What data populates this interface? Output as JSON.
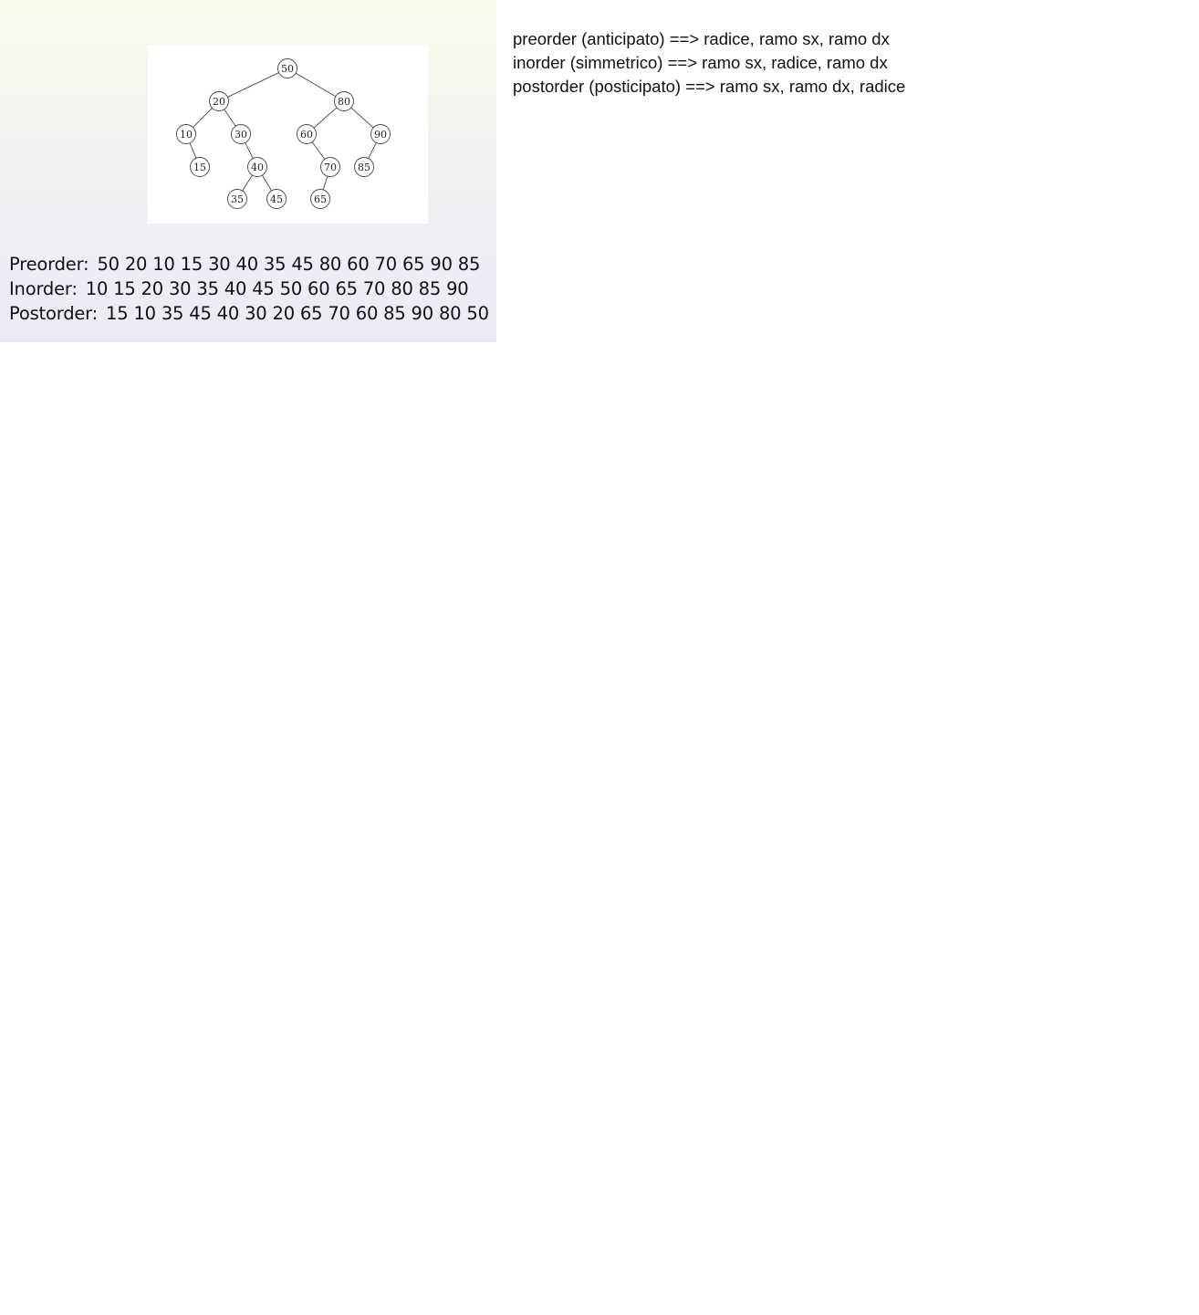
{
  "tree": {
    "nodes": [
      {
        "id": "50",
        "label": "50"
      },
      {
        "id": "20",
        "label": "20"
      },
      {
        "id": "80",
        "label": "80"
      },
      {
        "id": "10",
        "label": "10"
      },
      {
        "id": "30",
        "label": "30"
      },
      {
        "id": "60",
        "label": "60"
      },
      {
        "id": "90",
        "label": "90"
      },
      {
        "id": "15",
        "label": "15"
      },
      {
        "id": "40",
        "label": "40"
      },
      {
        "id": "70",
        "label": "70"
      },
      {
        "id": "85",
        "label": "85"
      },
      {
        "id": "35",
        "label": "35"
      },
      {
        "id": "45",
        "label": "45"
      },
      {
        "id": "65",
        "label": "65"
      }
    ],
    "edges": [
      [
        "50",
        "20"
      ],
      [
        "50",
        "80"
      ],
      [
        "20",
        "10"
      ],
      [
        "20",
        "30"
      ],
      [
        "80",
        "60"
      ],
      [
        "80",
        "90"
      ],
      [
        "10",
        "15"
      ],
      [
        "30",
        "40"
      ],
      [
        "60",
        "70"
      ],
      [
        "90",
        "85"
      ],
      [
        "40",
        "35"
      ],
      [
        "40",
        "45"
      ],
      [
        "70",
        "65"
      ]
    ]
  },
  "traversals": {
    "preorder": {
      "label": "Preorder:",
      "values": "50 20 10 15 30 40 35 45 80 60 70 65 90 85"
    },
    "inorder": {
      "label": "Inorder:",
      "values": "10 15 20 30 35 40 45 50 60 65 70 80 85 90"
    },
    "postorder": {
      "label": "Postorder:",
      "values": "15 10 35 45 40 30 20 65 70 60 85 90 80 50"
    }
  },
  "notes": {
    "line1": "preorder (anticipato) ==> radice, ramo sx, ramo dx",
    "line2": "inorder (simmetrico) ==> ramo sx, radice, ramo dx",
    "line3": "postorder (posticipato) ==> ramo sx, ramo dx, radice"
  }
}
